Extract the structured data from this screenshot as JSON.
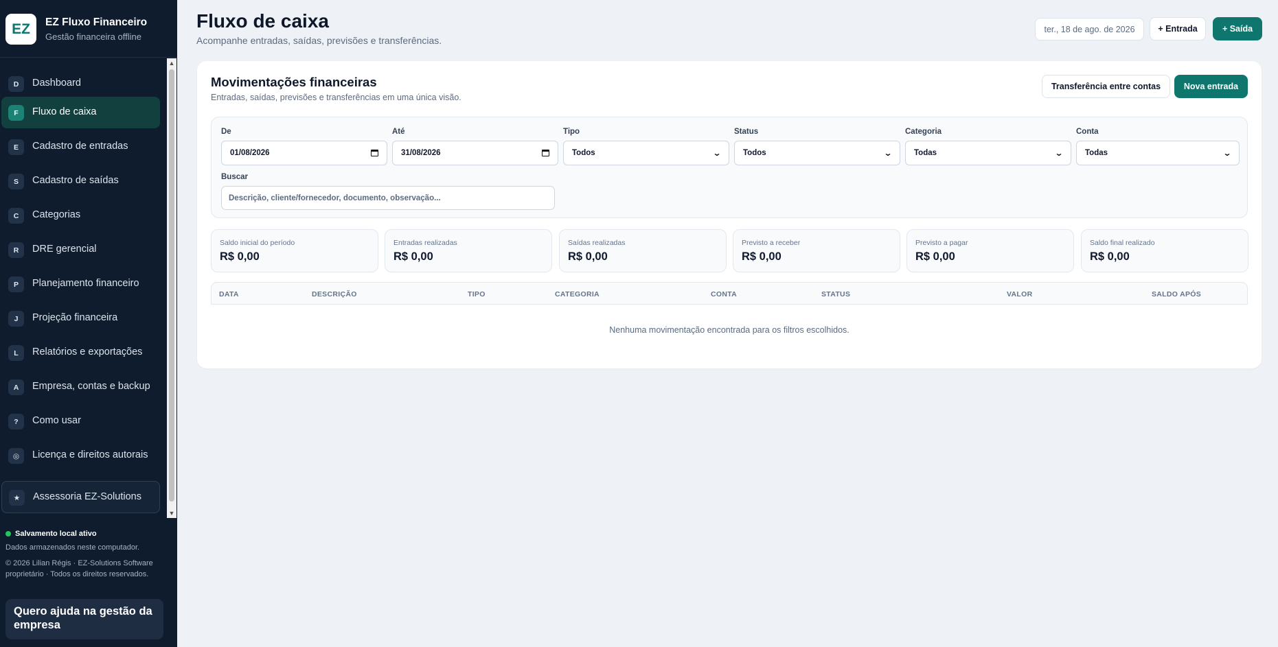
{
  "brand": {
    "logo": "EZ",
    "title": "EZ Fluxo Financeiro",
    "subtitle": "Gestão financeira offline"
  },
  "sidebar": {
    "items": [
      {
        "badge": "D",
        "label": "Dashboard"
      },
      {
        "badge": "F",
        "label": "Fluxo de caixa",
        "active": true
      },
      {
        "badge": "E",
        "label": "Cadastro de entradas"
      },
      {
        "badge": "S",
        "label": "Cadastro de saídas"
      },
      {
        "badge": "C",
        "label": "Categorias"
      },
      {
        "badge": "R",
        "label": "DRE gerencial"
      },
      {
        "badge": "P",
        "label": "Planejamento financeiro"
      },
      {
        "badge": "J",
        "label": "Projeção financeira"
      },
      {
        "badge": "L",
        "label": "Relatórios e exportações"
      },
      {
        "badge": "A",
        "label": "Empresa, contas e backup"
      },
      {
        "badge": "?",
        "label": "Como usar"
      },
      {
        "badge": "◎",
        "label": "Licença e direitos autorais"
      },
      {
        "badge": "★",
        "label": "Assessoria EZ-Solutions"
      }
    ],
    "status": "Salvamento local ativo",
    "status_sub": "Dados armazenados neste computador.",
    "copyright": "© 2026 Lilian Régis · EZ-Solutions Software proprietário · Todos os direitos reservados.",
    "help_card": "Quero ajuda na gestão da empresa"
  },
  "header": {
    "title": "Fluxo de caixa",
    "subtitle": "Acompanhe entradas, saídas, previsões e transferências.",
    "date": "ter., 18 de ago. de 2026",
    "entrada_button": "+ Entrada",
    "saida_button": "+ Saída"
  },
  "card": {
    "title": "Movimentações financeiras",
    "subtitle": "Entradas, saídas, previsões e transferências em uma única visão.",
    "transfer_button": "Transferência entre contas",
    "new_entry_button": "Nova entrada"
  },
  "filters": {
    "de": {
      "label": "De",
      "value": "01/08/2026"
    },
    "ate": {
      "label": "Até",
      "value": "31/08/2026"
    },
    "tipo": {
      "label": "Tipo",
      "value": "Todos"
    },
    "status": {
      "label": "Status",
      "value": "Todos"
    },
    "categoria": {
      "label": "Categoria",
      "value": "Todas"
    },
    "conta": {
      "label": "Conta",
      "value": "Todas"
    },
    "buscar": {
      "label": "Buscar",
      "placeholder": "Descrição, cliente/fornecedor, documento, observação..."
    }
  },
  "kpis": [
    {
      "label": "Saldo inicial do período",
      "value": "R$ 0,00"
    },
    {
      "label": "Entradas realizadas",
      "value": "R$ 0,00"
    },
    {
      "label": "Saídas realizadas",
      "value": "R$ 0,00"
    },
    {
      "label": "Previsto a receber",
      "value": "R$ 0,00"
    },
    {
      "label": "Previsto a pagar",
      "value": "R$ 0,00"
    },
    {
      "label": "Saldo final realizado",
      "value": "R$ 0,00"
    }
  ],
  "table": {
    "columns": [
      "DATA",
      "DESCRIÇÃO",
      "TIPO",
      "CATEGORIA",
      "CONTA",
      "STATUS",
      "VALOR",
      "SALDO APÓS"
    ],
    "empty_message": "Nenhuma movimentação encontrada para os filtros escolhidos."
  },
  "colors": {
    "sidebar_bg": "#0f1c2e",
    "accent": "#0f766e",
    "active_item": "#12403f",
    "page_bg": "#eef1f5",
    "status_dot": "#22c55e"
  },
  "icons": {
    "status": "status-dot-icon",
    "calendar": "calendar-icon",
    "select": "chevron-down-icon"
  }
}
